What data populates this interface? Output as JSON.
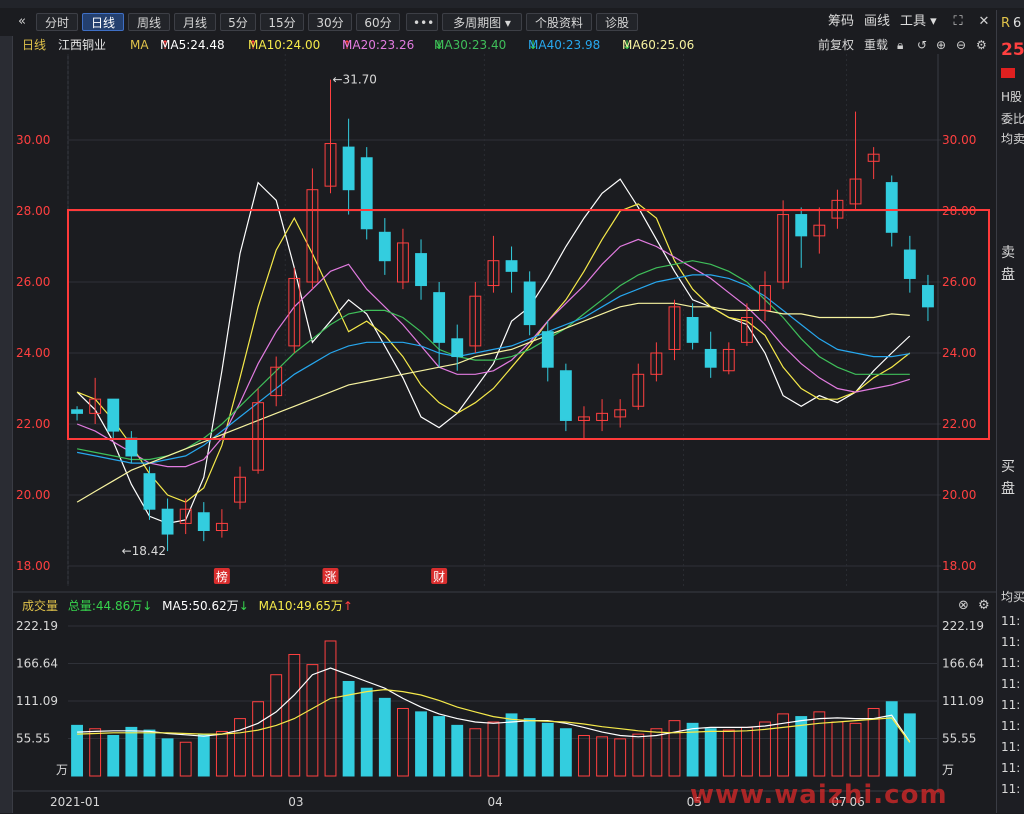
{
  "toolbar": {
    "back_icon": "double-chevron-left-icon",
    "intervals": [
      "分时",
      "日线",
      "周线",
      "月线",
      "5分",
      "15分",
      "30分",
      "60分"
    ],
    "active_interval": "日线",
    "more": "•••",
    "multi_period": "多周期图",
    "stock_profile": "个股资料",
    "diagnose": "诊股",
    "chips": "筹码",
    "draw": "画线",
    "tools": "工具"
  },
  "info": {
    "period": "日线",
    "stock_name": "江西铜业",
    "ma_label": "MA",
    "ma": [
      {
        "label": "MA5:24.48",
        "arrow": "↑",
        "color": "#ffffff",
        "arrow_color": "#ff4040"
      },
      {
        "label": "MA10:24.00",
        "arrow": "↑",
        "color": "#f5e94a",
        "arrow_color": "#ff4040"
      },
      {
        "label": "MA20:23.26",
        "arrow": "↑",
        "color": "#e27be0",
        "arrow_color": "#ff4040"
      },
      {
        "label": "MA30:23.40",
        "arrow": "↓",
        "color": "#3fbf5a",
        "arrow_color": "#36d34c"
      },
      {
        "label": "MA40:23.98",
        "arrow": "↓",
        "color": "#27a7ee",
        "arrow_color": "#36d34c"
      },
      {
        "label": "MA60:25.06",
        "arrow": "↓",
        "color": "#f7f3a0",
        "arrow_color": "#36d34c"
      }
    ],
    "restore": "前复权",
    "stack": "重载"
  },
  "price_axis": {
    "ticks": [
      "30.00",
      "28.00",
      "26.00",
      "24.00",
      "22.00",
      "20.00",
      "18.00"
    ]
  },
  "annotations": {
    "high": "31.70",
    "low": "18.42",
    "badges": [
      "榜",
      "涨",
      "财"
    ]
  },
  "volume_panel": {
    "title": "成交量",
    "total": "总量:44.86万",
    "total_arrow": "↓",
    "ma5": "MA5:50.62万",
    "ma5_arrow": "↓",
    "ma10": "MA10:49.65万",
    "ma10_arrow": "↑",
    "ticks": [
      "222.19",
      "166.64",
      "111.09",
      "55.55"
    ],
    "unit": "万"
  },
  "date_axis": [
    "2021-01",
    "03",
    "04",
    "05",
    "06",
    "07"
  ],
  "right_panel": {
    "top_char": "R",
    "top_digit": "6",
    "price_prefix": "25",
    "h_share": "H股",
    "commission": "委比",
    "avg_sell": "均卖",
    "sell": "卖",
    "sell2": "盘",
    "buy": "买",
    "buy2": "盘",
    "avg_buy": "均买",
    "times": [
      "11:",
      "11:",
      "11:",
      "11:",
      "11:",
      "11:",
      "11:",
      "11:",
      "11:"
    ]
  },
  "watermark": "www.waizhi.com",
  "colors": {
    "up": "#ff4040",
    "down": "#33cddf",
    "box": "#ff3a3a",
    "background": "#1b1c20"
  },
  "chart_data": [
    {
      "type": "candlestick",
      "title": "江西铜业 日线",
      "x_range": [
        "2021-01",
        "07"
      ],
      "ylim": [
        18.0,
        31.7
      ],
      "series": [
        {
          "name": "MA5",
          "values": [
            22.9,
            22.4,
            21.5,
            20.3,
            19.4,
            19.2,
            19.3,
            20.5,
            23.5,
            26.8,
            28.8,
            28.3,
            26.4,
            24.3,
            24.9,
            25.5,
            25.1,
            24.2,
            23.3,
            22.2,
            21.9,
            22.3,
            23.0,
            23.7,
            24.9,
            25.3,
            26.1,
            27.0,
            27.8,
            28.5,
            28.9,
            28.1,
            27.2,
            26.3,
            25.5,
            25.3,
            25.0,
            24.8,
            24.0,
            22.8,
            22.5,
            22.8,
            22.6,
            22.9,
            23.5,
            24.0,
            24.48
          ]
        },
        {
          "name": "MA10",
          "values": [
            22.9,
            22.7,
            22.1,
            21.4,
            20.6,
            20.0,
            19.8,
            20.2,
            21.4,
            23.3,
            25.3,
            26.9,
            27.8,
            26.8,
            25.7,
            24.6,
            24.9,
            24.5,
            23.9,
            23.1,
            22.6,
            22.3,
            22.6,
            23.0,
            23.6,
            24.2,
            24.9,
            25.5,
            26.3,
            27.2,
            28.0,
            28.2,
            27.8,
            26.6,
            25.8,
            25.3,
            25.0,
            24.9,
            24.5,
            23.6,
            23.0,
            22.7,
            22.7,
            22.9,
            23.3,
            23.6,
            24.0
          ]
        },
        {
          "name": "MA20",
          "values": [
            22.0,
            21.8,
            21.5,
            21.2,
            20.9,
            20.8,
            20.8,
            21.0,
            21.6,
            22.6,
            23.7,
            24.6,
            25.3,
            25.8,
            26.3,
            26.5,
            25.8,
            25.3,
            24.8,
            24.2,
            23.6,
            23.4,
            23.4,
            23.5,
            23.8,
            24.3,
            24.9,
            25.4,
            25.9,
            26.5,
            27.0,
            27.2,
            27.0,
            26.7,
            26.4,
            26.1,
            25.7,
            25.3,
            24.8,
            24.2,
            23.7,
            23.3,
            23.0,
            22.9,
            23.0,
            23.1,
            23.26
          ]
        },
        {
          "name": "MA30",
          "values": [
            21.3,
            21.2,
            21.1,
            21.0,
            21.0,
            21.1,
            21.3,
            21.6,
            22.0,
            22.5,
            23.0,
            23.5,
            24.0,
            24.4,
            24.8,
            25.1,
            25.2,
            25.2,
            25.0,
            24.6,
            24.1,
            23.9,
            23.8,
            23.8,
            23.9,
            24.1,
            24.4,
            24.7,
            25.1,
            25.5,
            25.9,
            26.2,
            26.4,
            26.5,
            26.6,
            26.5,
            26.3,
            26.0,
            25.5,
            25.0,
            24.4,
            23.9,
            23.6,
            23.4,
            23.4,
            23.4,
            23.4
          ]
        },
        {
          "name": "MA40",
          "values": [
            21.2,
            21.1,
            21.0,
            20.9,
            20.9,
            21.0,
            21.1,
            21.4,
            21.8,
            22.2,
            22.6,
            23.0,
            23.4,
            23.7,
            24.0,
            24.2,
            24.3,
            24.3,
            24.3,
            24.2,
            24.0,
            23.9,
            24.0,
            24.1,
            24.2,
            24.4,
            24.6,
            24.8,
            25.0,
            25.3,
            25.6,
            25.8,
            26.0,
            26.1,
            26.2,
            26.2,
            26.1,
            25.9,
            25.6,
            25.2,
            24.8,
            24.4,
            24.1,
            24.0,
            23.9,
            23.9,
            23.98
          ]
        },
        {
          "name": "MA60",
          "values": [
            19.8,
            20.1,
            20.4,
            20.7,
            20.9,
            21.1,
            21.3,
            21.5,
            21.7,
            21.9,
            22.1,
            22.3,
            22.5,
            22.7,
            22.9,
            23.1,
            23.2,
            23.3,
            23.4,
            23.5,
            23.6,
            23.7,
            23.9,
            24.0,
            24.1,
            24.3,
            24.5,
            24.7,
            24.9,
            25.1,
            25.3,
            25.4,
            25.4,
            25.4,
            25.3,
            25.3,
            25.2,
            25.2,
            25.2,
            25.1,
            25.1,
            25.0,
            25.0,
            25.0,
            25.0,
            25.1,
            25.06
          ]
        }
      ],
      "candles": [
        [
          22.4,
          22.3,
          22.5,
          22.1
        ],
        [
          22.3,
          22.7,
          23.3,
          22.0
        ],
        [
          22.7,
          21.8,
          22.4,
          21.6
        ],
        [
          21.6,
          21.1,
          21.8,
          20.9
        ],
        [
          20.6,
          19.6,
          20.8,
          19.3
        ],
        [
          19.6,
          18.9,
          19.9,
          18.42
        ],
        [
          19.2,
          19.6,
          19.9,
          18.9
        ],
        [
          19.5,
          19.0,
          19.8,
          18.7
        ],
        [
          19.0,
          19.2,
          19.6,
          18.8
        ],
        [
          19.8,
          20.5,
          20.8,
          19.6
        ],
        [
          20.7,
          22.6,
          23.0,
          20.6
        ],
        [
          22.8,
          23.6,
          23.9,
          22.5
        ],
        [
          24.2,
          26.1,
          26.4,
          24.0
        ],
        [
          26.0,
          28.6,
          29.2,
          25.8
        ],
        [
          28.7,
          29.9,
          31.7,
          28.5
        ],
        [
          29.8,
          28.6,
          30.6,
          27.9
        ],
        [
          29.5,
          27.5,
          29.8,
          27.2
        ],
        [
          27.4,
          26.6,
          27.8,
          26.2
        ],
        [
          26.0,
          27.1,
          27.5,
          25.8
        ],
        [
          26.8,
          25.9,
          27.2,
          25.5
        ],
        [
          25.7,
          24.3,
          26.0,
          23.6
        ],
        [
          24.4,
          23.9,
          24.8,
          23.5
        ],
        [
          24.2,
          25.6,
          26.0,
          24.0
        ],
        [
          25.9,
          26.6,
          27.3,
          25.7
        ],
        [
          26.6,
          26.3,
          27.0,
          25.7
        ],
        [
          26.0,
          24.8,
          26.3,
          24.5
        ],
        [
          24.6,
          23.6,
          24.9,
          23.2
        ],
        [
          23.5,
          22.1,
          23.7,
          21.8
        ],
        [
          22.1,
          22.2,
          22.5,
          21.6
        ],
        [
          22.1,
          22.3,
          22.7,
          21.8
        ],
        [
          22.2,
          22.4,
          22.7,
          21.9
        ],
        [
          22.5,
          23.4,
          23.7,
          22.4
        ],
        [
          23.4,
          24.0,
          24.3,
          23.2
        ],
        [
          24.1,
          25.3,
          25.5,
          23.8
        ],
        [
          25.0,
          24.3,
          25.4,
          24.1
        ],
        [
          24.1,
          23.6,
          24.6,
          23.3
        ],
        [
          23.5,
          24.1,
          24.3,
          23.4
        ],
        [
          24.3,
          25.0,
          25.4,
          24.2
        ],
        [
          25.2,
          25.9,
          26.3,
          24.9
        ],
        [
          26.0,
          27.9,
          28.3,
          25.8
        ],
        [
          27.9,
          27.3,
          28.1,
          26.4
        ],
        [
          27.3,
          27.6,
          28.1,
          26.8
        ],
        [
          27.8,
          28.3,
          28.6,
          27.5
        ],
        [
          28.2,
          28.9,
          30.8,
          28.0
        ],
        [
          29.4,
          29.6,
          29.8,
          28.9
        ],
        [
          28.8,
          27.4,
          29.0,
          27.0
        ],
        [
          26.9,
          26.1,
          27.3,
          25.7
        ],
        [
          25.9,
          25.3,
          26.2,
          24.9
        ]
      ]
    },
    {
      "type": "bar",
      "title": "成交量",
      "ylabel": "万",
      "ylim": [
        0,
        222.19
      ],
      "series": [
        {
          "name": "成交量",
          "values": [
            75,
            70,
            60,
            72,
            68,
            55,
            50,
            62,
            66,
            85,
            110,
            150,
            180,
            165,
            200,
            140,
            130,
            115,
            100,
            95,
            88,
            75,
            70,
            80,
            92,
            85,
            78,
            70,
            60,
            58,
            55,
            62,
            70,
            82,
            78,
            70,
            68,
            72,
            80,
            92,
            88,
            95,
            80,
            78,
            100,
            110,
            92
          ]
        },
        {
          "name": "MA5",
          "values": [
            65,
            66,
            67,
            67,
            66,
            63,
            61,
            59,
            62,
            68,
            78,
            95,
            120,
            150,
            160,
            150,
            140,
            130,
            115,
            102,
            92,
            85,
            80,
            78,
            80,
            82,
            82,
            78,
            72,
            65,
            60,
            58,
            60,
            65,
            70,
            72,
            72,
            72,
            74,
            78,
            82,
            85,
            86,
            85,
            85,
            90,
            50.62
          ]
        },
        {
          "name": "MA10",
          "values": [
            62,
            63,
            64,
            64,
            64,
            64,
            63,
            62,
            62,
            64,
            68,
            75,
            85,
            100,
            115,
            120,
            125,
            128,
            125,
            120,
            112,
            102,
            95,
            88,
            84,
            82,
            81,
            80,
            77,
            73,
            70,
            67,
            65,
            64,
            65,
            66,
            66,
            67,
            69,
            72,
            75,
            78,
            80,
            82,
            84,
            86,
            49.65
          ]
        }
      ]
    }
  ]
}
